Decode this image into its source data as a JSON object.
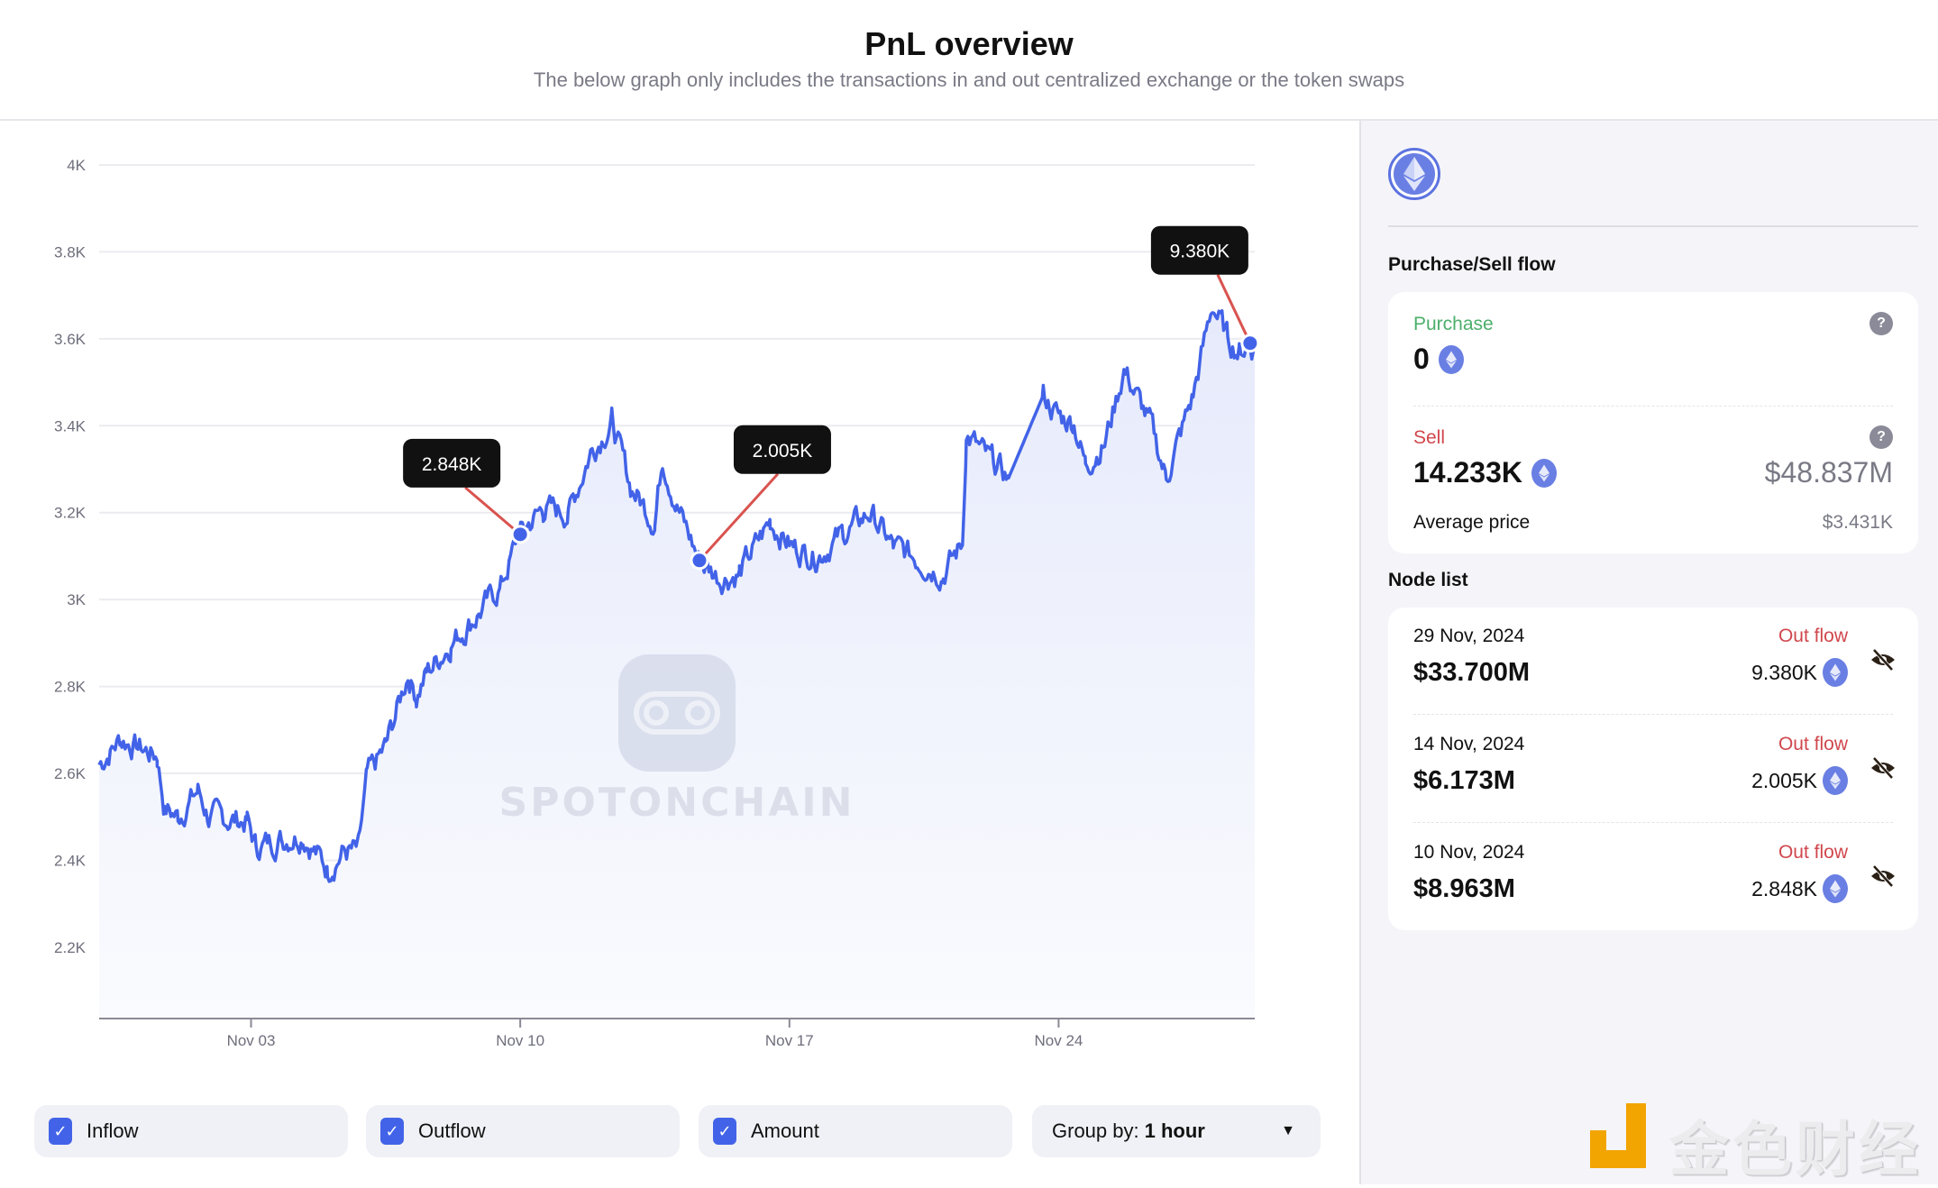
{
  "header": {
    "title": "PnL overview",
    "subtitle": "The below graph only includes the transactions in and out centralized exchange or the token swaps"
  },
  "chart_data": {
    "type": "area",
    "title": "",
    "xlabel": "",
    "ylabel": "",
    "x_unit": "days since Nov 03",
    "ylim": [
      2.036,
      4.0
    ],
    "xlim": [
      -3.95,
      26.1
    ],
    "y_ticks": [
      {
        "value": 4.0,
        "label": "4K"
      },
      {
        "value": 3.8,
        "label": "3.8K"
      },
      {
        "value": 3.6,
        "label": "3.6K"
      },
      {
        "value": 3.4,
        "label": "3.4K"
      },
      {
        "value": 3.2,
        "label": "3.2K"
      },
      {
        "value": 3.0,
        "label": "3K"
      },
      {
        "value": 2.8,
        "label": "2.8K"
      },
      {
        "value": 2.6,
        "label": "2.6K"
      },
      {
        "value": 2.4,
        "label": "2.4K"
      },
      {
        "value": 2.2,
        "label": "2.2K"
      }
    ],
    "x_ticks": [
      {
        "value": 0,
        "label": "Nov 03"
      },
      {
        "value": 7,
        "label": "Nov 10"
      },
      {
        "value": 14,
        "label": "Nov 17"
      },
      {
        "value": 21,
        "label": "Nov 24"
      }
    ],
    "grid": true,
    "series": [
      {
        "name": "ETH price",
        "color": "#4263e8",
        "x": [
          -3.95,
          -3.4,
          -2.44,
          -2.25,
          -1.9,
          -1.38,
          -1.1,
          -0.1,
          0.13,
          0.8,
          1.35,
          1.99,
          2.4,
          2.79,
          3.02,
          3.5,
          4.08,
          4.3,
          4.56,
          5.2,
          5.84,
          6.5,
          6.97,
          7.6,
          8.25,
          8.83,
          9.38,
          9.87,
          10.5,
          10.7,
          11.1,
          11.66,
          12.2,
          12.7,
          13.5,
          14.1,
          14.7,
          15.4,
          16.1,
          16.7,
          17.2,
          18.0,
          18.5,
          18.6,
          19.1,
          19.7,
          20.6,
          21.0,
          21.4,
          21.7,
          22.2,
          22.7,
          23.4,
          23.8,
          24.5,
          25.0,
          25.4,
          25.7,
          25.98,
          26.1
        ],
        "y": [
          2.62,
          2.68,
          2.64,
          2.52,
          2.5,
          2.56,
          2.5,
          2.49,
          2.43,
          2.45,
          2.46,
          2.38,
          2.42,
          2.42,
          2.59,
          2.66,
          2.83,
          2.78,
          2.83,
          2.9,
          2.96,
          3.03,
          3.15,
          3.21,
          3.2,
          3.34,
          3.41,
          3.26,
          3.18,
          3.33,
          3.21,
          3.09,
          3.05,
          3.06,
          3.18,
          3.12,
          3.1,
          3.15,
          3.2,
          3.12,
          3.1,
          3.06,
          3.13,
          3.38,
          3.33,
          3.28,
          3.47,
          3.42,
          3.41,
          3.31,
          3.36,
          3.53,
          3.4,
          3.28,
          3.47,
          3.68,
          3.6,
          3.57,
          3.59,
          3.57
        ]
      }
    ],
    "annotations": [
      {
        "label": "2.848K",
        "x": 7.0,
        "y": 3.15
      },
      {
        "label": "2.005K",
        "x": 11.66,
        "y": 3.09
      },
      {
        "label": "9.380K",
        "x": 25.98,
        "y": 3.59
      }
    ],
    "watermark": "SPOTONCHAIN"
  },
  "controls": {
    "inflow": {
      "label": "Inflow",
      "checked": true
    },
    "outflow": {
      "label": "Outflow",
      "checked": true
    },
    "amount": {
      "label": "Amount",
      "checked": true
    },
    "group_by": {
      "label": "Group by:",
      "value": "1 hour"
    }
  },
  "panel": {
    "token_icon": "ethereum-icon",
    "flow_title": "Purchase/Sell flow",
    "purchase": {
      "label": "Purchase",
      "amount": "0"
    },
    "sell": {
      "label": "Sell",
      "amount": "14.233K",
      "usd": "$48.837M",
      "avg_label": "Average price",
      "avg_value": "$3.431K"
    },
    "node_title": "Node list",
    "nodes": [
      {
        "date": "29 Nov, 2024",
        "usd": "$33.700M",
        "flow": "Out flow",
        "amount": "9.380K"
      },
      {
        "date": "14 Nov, 2024",
        "usd": "$6.173M",
        "flow": "Out flow",
        "amount": "2.005K"
      },
      {
        "date": "10 Nov, 2024",
        "usd": "$8.963M",
        "flow": "Out flow",
        "amount": "2.848K"
      }
    ]
  },
  "colors": {
    "accent": "#4263e8",
    "eth": "#6a7fe3",
    "purchase": "#4caf6a",
    "sell": "#d0474d",
    "annotation_line": "#d9534f",
    "tooltip_bg": "#111111"
  },
  "watermark_logo": "金色财经"
}
